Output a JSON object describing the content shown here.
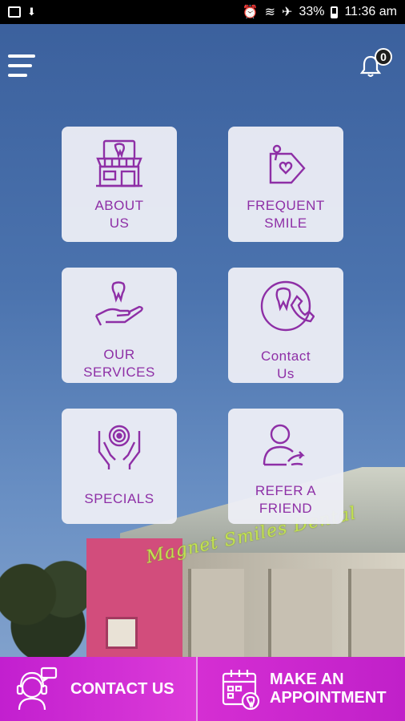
{
  "status_bar": {
    "battery": "33%",
    "time": "11:36 am"
  },
  "header": {
    "notification_count": "0"
  },
  "tiles": [
    {
      "label": "ABOUT\nUS",
      "icon": "dental-clinic-icon"
    },
    {
      "label": "FREQUENT\nSMILE",
      "icon": "heart-tag-icon"
    },
    {
      "label": "OUR\nSERVICES",
      "icon": "tooth-hand-icon"
    },
    {
      "label": "Contact\nUs",
      "icon": "tooth-phone-icon"
    },
    {
      "label": "SPECIALS",
      "icon": "target-hands-icon"
    },
    {
      "label": "REFER A\nFRIEND",
      "icon": "user-share-icon"
    }
  ],
  "background_sign": "Magnet Smiles Dental",
  "bottom_bar": {
    "contact_label": "CONTACT US",
    "appointment_label": "MAKE AN\nAPPOINTMENT"
  },
  "colors": {
    "accent": "#8e2fa6",
    "bottom_bar": "#d02bd0",
    "tile_bg": "#edeef5"
  }
}
